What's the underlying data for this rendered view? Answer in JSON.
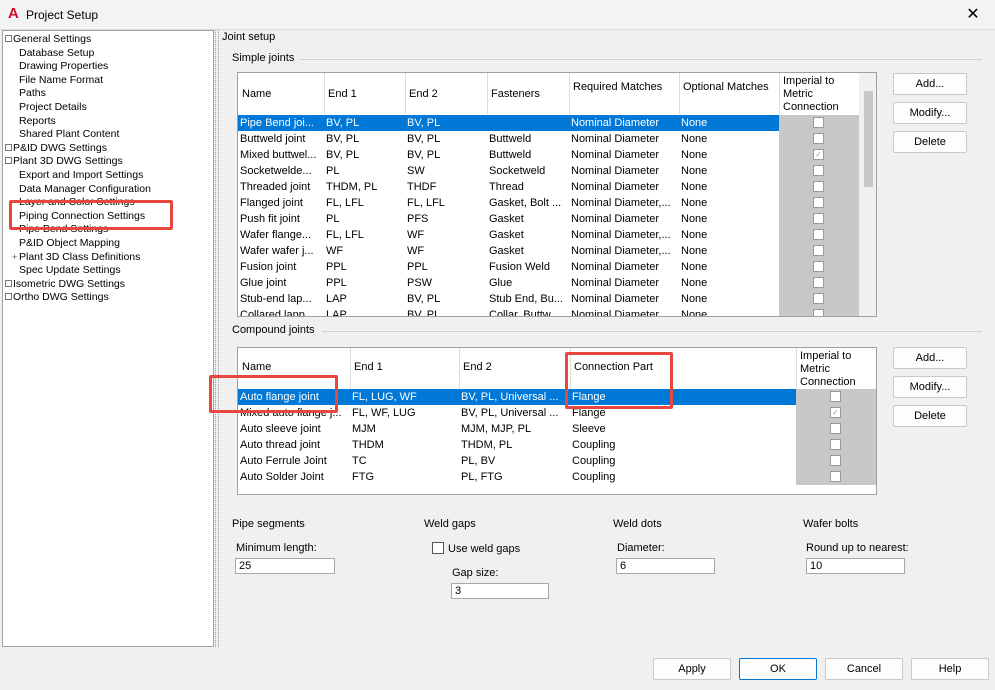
{
  "window": {
    "title": "Project Setup",
    "app_icon": "autocad-a-icon",
    "close_label": "✕"
  },
  "tree": [
    {
      "label": "General Settings",
      "level": 0,
      "toggle": true
    },
    {
      "label": "Database Setup",
      "level": 1
    },
    {
      "label": "Drawing Properties",
      "level": 1
    },
    {
      "label": "File Name Format",
      "level": 1
    },
    {
      "label": "Paths",
      "level": 1
    },
    {
      "label": "Project Details",
      "level": 1
    },
    {
      "label": "Reports",
      "level": 1
    },
    {
      "label": "Shared Plant Content",
      "level": 1
    },
    {
      "label": "P&ID DWG Settings",
      "level": 0,
      "toggle": true
    },
    {
      "label": "Plant 3D DWG Settings",
      "level": 0,
      "toggle": true
    },
    {
      "label": "Export and Import Settings",
      "level": 1
    },
    {
      "label": "Data Manager Configuration",
      "level": 1
    },
    {
      "label": "Layer and Color Settings",
      "level": 1
    },
    {
      "label": "Piping Connection Settings",
      "level": 1,
      "selected": true
    },
    {
      "label": "Pipe Bend Settings",
      "level": 1
    },
    {
      "label": "P&ID Object Mapping",
      "level": 1
    },
    {
      "label": "Plant 3D Class Definitions",
      "level": 1,
      "plus": true
    },
    {
      "label": "Spec Update Settings",
      "level": 1
    },
    {
      "label": "Isometric DWG Settings",
      "level": 0,
      "toggle": true
    },
    {
      "label": "Ortho DWG Settings",
      "level": 0,
      "toggle": true
    }
  ],
  "joint_setup": {
    "title": "Joint setup"
  },
  "simple_joints": {
    "title": "Simple joints",
    "headers": [
      "Name",
      "End 1",
      "End 2",
      "Fasteners",
      "Required Matches",
      "Optional Matches",
      "Imperial to Metric Connection"
    ],
    "rows": [
      [
        "Pipe Bend joi...",
        "BV, PL",
        "BV, PL",
        "",
        "Nominal Diameter",
        "None",
        "off"
      ],
      [
        "Buttweld joint",
        "BV, PL",
        "BV, PL",
        "Buttweld",
        "Nominal Diameter",
        "None",
        "off"
      ],
      [
        "Mixed buttwel...",
        "BV, PL",
        "BV, PL",
        "Buttweld",
        "Nominal Diameter",
        "None",
        "on"
      ],
      [
        "Socketwelde...",
        "PL",
        "SW",
        "Socketweld",
        "Nominal Diameter",
        "None",
        "off"
      ],
      [
        "Threaded joint",
        "THDM, PL",
        "THDF",
        "Thread",
        "Nominal Diameter",
        "None",
        "off"
      ],
      [
        "Flanged joint",
        "FL, LFL",
        "FL, LFL",
        "Gasket, Bolt ...",
        "Nominal Diameter,...",
        "None",
        "off"
      ],
      [
        "Push fit joint",
        "PL",
        "PFS",
        "Gasket",
        "Nominal Diameter",
        "None",
        "off"
      ],
      [
        "Wafer flange...",
        "FL, LFL",
        "WF",
        "Gasket",
        "Nominal Diameter,...",
        "None",
        "off"
      ],
      [
        "Wafer wafer j...",
        "WF",
        "WF",
        "Gasket",
        "Nominal Diameter,...",
        "None",
        "off"
      ],
      [
        "Fusion joint",
        "PPL",
        "PPL",
        "Fusion Weld",
        "Nominal Diameter",
        "None",
        "off"
      ],
      [
        "Glue joint",
        "PPL",
        "PSW",
        "Glue",
        "Nominal Diameter",
        "None",
        "off"
      ],
      [
        "Stub-end lap...",
        "LAP",
        "BV, PL",
        "Stub End, Bu...",
        "Nominal Diameter",
        "None",
        "off"
      ],
      [
        "Collared lapp...",
        "LAP",
        "BV, PL",
        "Collar, Buttw...",
        "Nominal Diameter",
        "None",
        "off"
      ]
    ],
    "buttons": [
      "Add...",
      "Modify...",
      "Delete"
    ]
  },
  "compound_joints": {
    "title": "Compound joints",
    "headers": [
      "Name",
      "End 1",
      "End 2",
      "Connection Part",
      "Imperial to Metric Connection"
    ],
    "rows": [
      [
        "Auto flange joint",
        "FL, LUG, WF",
        "BV, PL, Universal ...",
        "Flange",
        "off"
      ],
      [
        "Mixed auto flange j...",
        "FL, WF, LUG",
        "BV, PL, Universal ...",
        "Flange",
        "on"
      ],
      [
        "Auto sleeve joint",
        "MJM",
        "MJM, MJP, PL",
        "Sleeve",
        "off"
      ],
      [
        "Auto thread joint",
        "THDM",
        "THDM, PL",
        "Coupling",
        "off"
      ],
      [
        "Auto Ferrule Joint",
        "TC",
        "PL, BV",
        "Coupling",
        "off"
      ],
      [
        "Auto Solder Joint",
        "FTG",
        "PL, FTG",
        "Coupling",
        "off"
      ]
    ],
    "buttons": [
      "Add...",
      "Modify...",
      "Delete"
    ]
  },
  "pipe_segments": {
    "title": "Pipe segments",
    "label": "Minimum length:",
    "value": "25"
  },
  "weld_gaps": {
    "title": "Weld gaps",
    "checkbox_label": "Use weld gaps",
    "gap_label": "Gap size:",
    "gap_value": "3"
  },
  "weld_dots": {
    "title": "Weld dots",
    "label": "Diameter:",
    "value": "6"
  },
  "wafer_bolts": {
    "title": "Wafer bolts",
    "label": "Round up to nearest:",
    "value": "10"
  },
  "footer": {
    "apply": "Apply",
    "ok": "OK",
    "cancel": "Cancel",
    "help": "Help"
  },
  "colors": {
    "selection": "#0078d7",
    "highlight_box": "#e8473f"
  }
}
